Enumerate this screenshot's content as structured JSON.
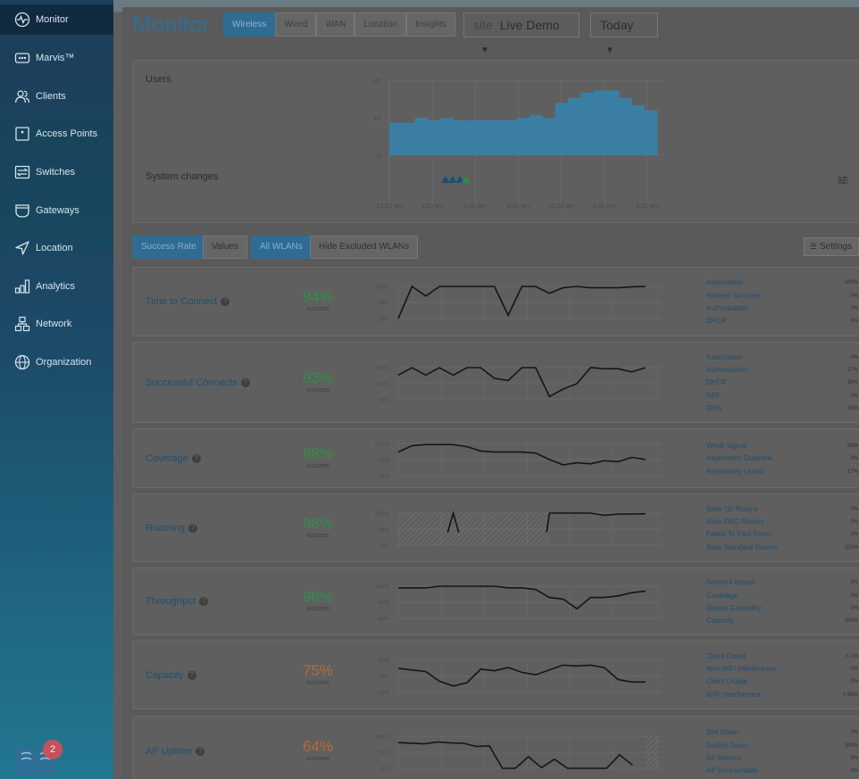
{
  "sidebar": {
    "items": [
      {
        "label": "Monitor",
        "icon": "monitor-icon"
      },
      {
        "label": "Marvis™",
        "icon": "marvis-icon"
      },
      {
        "label": "Clients",
        "icon": "clients-icon"
      },
      {
        "label": "Access Points",
        "icon": "access-point-icon"
      },
      {
        "label": "Switches",
        "icon": "switch-icon"
      },
      {
        "label": "Gateways",
        "icon": "gateway-icon"
      },
      {
        "label": "Location",
        "icon": "location-icon"
      },
      {
        "label": "Analytics",
        "icon": "analytics-icon"
      },
      {
        "label": "Network",
        "icon": "network-icon"
      },
      {
        "label": "Organization",
        "icon": "organization-icon"
      }
    ],
    "help_badge": "2"
  },
  "header": {
    "title": "Monitor",
    "view_tabs": [
      "Wireless",
      "Wired",
      "WAN",
      "Location",
      "Insights"
    ],
    "active_tab": "Wireless",
    "site_label": "site",
    "site_value": "Live Demo",
    "time_range": "Today"
  },
  "timeline": {
    "users_label": "Users",
    "system_changes_label": "System changes",
    "y_ticks": [
      "30",
      "15",
      "0"
    ],
    "x_ticks": [
      "12:00 am",
      "3:00 am",
      "6:00 am",
      "9:00 am",
      "12:00 pm",
      "3:00 pm",
      "6:00 pm"
    ],
    "user_counts": [
      13,
      13,
      15,
      14,
      15,
      14,
      14,
      14,
      14,
      14,
      15,
      16,
      15,
      21,
      23,
      25,
      26,
      26,
      23,
      20,
      18
    ],
    "ymax": 30,
    "colors": {
      "bars": "#3a7fa3",
      "change_blue": "#1d4f79",
      "change_green": "#2d8f3e"
    }
  },
  "toolbar": {
    "metric_tabs": [
      "Success Rate",
      "Values"
    ],
    "wlan_tabs": [
      "All WLANs",
      "Hide Excluded WLANs"
    ],
    "settings": "Settings"
  },
  "sle": [
    {
      "name": "Time to Connect",
      "pct": "94%",
      "color": "#2f9146",
      "axis": [
        "100%",
        "60%",
        "20%"
      ],
      "ymin": 20,
      "ymax": 100,
      "values": [
        20,
        100,
        76,
        100,
        100,
        100,
        100,
        100,
        28,
        100,
        100,
        83,
        97,
        100,
        97,
        97,
        97,
        99,
        100
      ],
      "reasons": [
        [
          "Association",
          "100%"
        ],
        [
          "Internet Services",
          "0%"
        ],
        [
          "Authorization",
          "0%"
        ],
        [
          "DHCP",
          "0%"
        ]
      ]
    },
    {
      "name": "Successful Connects",
      "pct": "93%",
      "color": "#2f9146",
      "axis": [
        "100%",
        "85%",
        "70%"
      ],
      "ymin": 70,
      "ymax": 100,
      "values": [
        93,
        100,
        93,
        100,
        93,
        100,
        100,
        90,
        88,
        100,
        100,
        73,
        80,
        85,
        100,
        99,
        99,
        96,
        100
      ],
      "reasons": [
        [
          "Association",
          "0%"
        ],
        [
          "Authorization",
          "27%"
        ],
        [
          "DHCP",
          "38%"
        ],
        [
          "ARP",
          "0%"
        ],
        [
          "DNS",
          "35%"
        ]
      ]
    },
    {
      "name": "Coverage",
      "pct": "88%",
      "color": "#2f9146",
      "axis": [
        "100%",
        "85%",
        "70%"
      ],
      "ymin": 70,
      "ymax": 100,
      "values": [
        92,
        98,
        99,
        99,
        99,
        97,
        93,
        92,
        92,
        92,
        91,
        85,
        80,
        82,
        81,
        84,
        83,
        87,
        85
      ],
      "reasons": [
        [
          "Weak Signal",
          "83%"
        ],
        [
          "Asymmetry Downlink",
          "0%"
        ],
        [
          "Asymmetry Uplink",
          "17%"
        ]
      ]
    },
    {
      "name": "Roaming",
      "pct": "98%",
      "color": "#2f9146",
      "axis": [
        "100%",
        "50%",
        "0%"
      ],
      "ymin": 0,
      "ymax": 100,
      "values": [
        null,
        null,
        null,
        null,
        null,
        null,
        null,
        null,
        null,
        null,
        null,
        100,
        100,
        100,
        100,
        93,
        97,
        97,
        98
      ],
      "spikes": [
        [
          3.6,
          40
        ],
        [
          4.0,
          100
        ],
        [
          4.4,
          40
        ],
        [
          10.8,
          40
        ],
        [
          11.0,
          100
        ]
      ],
      "reasons": [
        [
          "Slow 11r Roams",
          "0%"
        ],
        [
          "Slow OKC Roams",
          "0%"
        ],
        [
          "Failed To Fast Roam",
          "0%"
        ],
        [
          "Slow Standard Roams",
          "100%"
        ]
      ]
    },
    {
      "name": "Throughput",
      "pct": "96%",
      "color": "#2f9146",
      "axis": [
        "100%",
        "90%",
        "80%"
      ],
      "ymin": 80,
      "ymax": 100,
      "values": [
        99,
        99,
        99,
        100,
        100,
        100,
        100,
        100,
        99,
        99,
        98,
        93,
        92,
        86,
        93,
        93,
        94,
        96,
        97
      ],
      "reasons": [
        [
          "Network Issues",
          "0%"
        ],
        [
          "Coverage",
          "0%"
        ],
        [
          "Device Capability",
          "0%"
        ],
        [
          "Capacity",
          "100%"
        ]
      ]
    },
    {
      "name": "Capacity",
      "pct": "75%",
      "color": "#b86a3a",
      "axis": [
        "90%",
        "70%",
        "50%"
      ],
      "ymin": 50,
      "ymax": 90,
      "values": [
        80,
        78,
        76,
        64,
        58,
        62,
        79,
        77,
        81,
        75,
        72,
        78,
        84,
        83,
        84,
        81,
        66,
        63,
        63
      ],
      "reasons": [
        [
          "Client Count",
          "< 1%"
        ],
        [
          "Non WiFi Interference",
          "0%"
        ],
        [
          "Client Usage",
          "0%"
        ],
        [
          "WiFi Interference",
          "> 99%"
        ]
      ]
    },
    {
      "name": "AP Uptime",
      "pct": "64%",
      "color": "#b86a3a",
      "axis": [
        "100%",
        "50%",
        "0%"
      ],
      "ymin": 0,
      "ymax": 100,
      "values": [
        80,
        78,
        76,
        82,
        79,
        78,
        68,
        70,
        0,
        0,
        36,
        2,
        28,
        0,
        0,
        0,
        0,
        42,
        10,
        null
      ],
      "reasons": [
        [
          "Site Down",
          "0%"
        ],
        [
          "Switch Down",
          "100%"
        ],
        [
          "AP Reboot",
          "0%"
        ],
        [
          "AP Unreachable",
          "0%"
        ]
      ]
    }
  ]
}
